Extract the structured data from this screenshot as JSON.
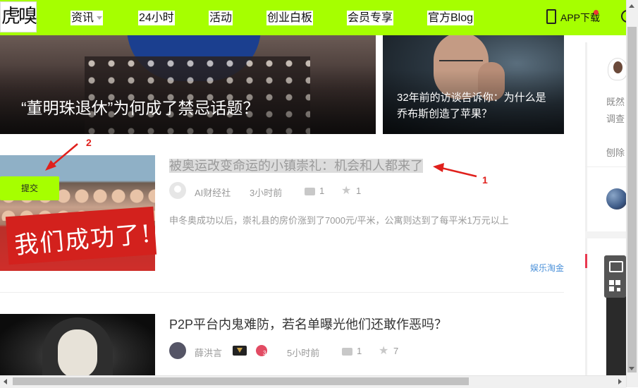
{
  "header": {
    "logo": "虎嗅",
    "nav": [
      {
        "label": "资讯",
        "dropdown": true
      },
      {
        "label": "24小时"
      },
      {
        "label": "活动"
      },
      {
        "label": "创业白板"
      },
      {
        "label": "会员专享"
      },
      {
        "label": "官方Blog"
      }
    ],
    "app_download": "APP下载",
    "accent_color": "#a6ff00"
  },
  "hero": [
    {
      "title": "“董明珠退休”为何成了禁忌话题？"
    },
    {
      "title": "32年前的访谈告诉你：为什么是乔布斯创造了苹果？"
    }
  ],
  "articles": [
    {
      "title": "被奥运改变命运的小镇崇礼：机会和人都来了",
      "author": "AI财经社",
      "time": "3小时前",
      "comments": "1",
      "favorites": "1",
      "summary": "申冬奥成功以后，崇礼县的房价涨到了7000元/平米，公寓则达到了每平米1万元以上",
      "tag": "娱乐淘金",
      "thumb_banner_text": "我们成功了!",
      "submit_button": "提交"
    },
    {
      "title": "P2P平台内鬼难防，若名单曝光他们还敢作恶吗？",
      "author": "薛洪言",
      "time": "5小时前",
      "comments": "1",
      "favorites": "7"
    }
  ],
  "annotations": {
    "label1": "1",
    "label2": "2",
    "color": "#e0201c"
  },
  "sidebar": {
    "line1": "既然",
    "line2": "调查",
    "line3": "刨除"
  }
}
